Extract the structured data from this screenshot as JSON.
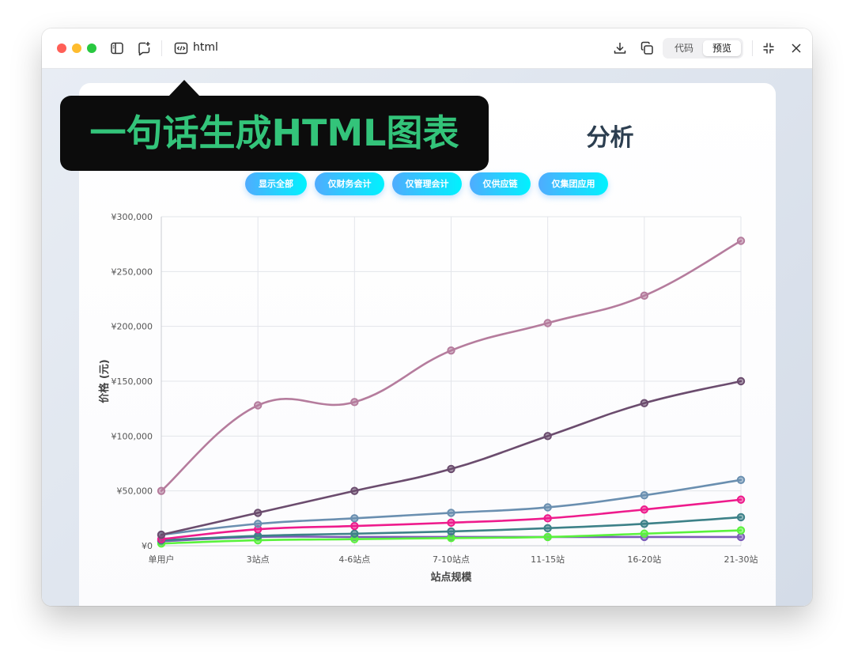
{
  "window": {
    "tab_title": "html",
    "view_toggle": {
      "code_label": "代码",
      "preview_label": "预览",
      "active": "预览"
    },
    "traffic_lights": [
      "#ff5f57",
      "#febc2e",
      "#28c840"
    ],
    "icons": [
      "sidebar-icon",
      "new-chat-icon",
      "code-file-icon",
      "download-icon",
      "copy-icon",
      "collapse-icon",
      "close-icon"
    ]
  },
  "banner": {
    "text": "一句话生成HTML图表",
    "color": "#33c47a"
  },
  "page": {
    "title_visible_fragment": "分析",
    "filters": [
      "显示全部",
      "仅财务会计",
      "仅管理会计",
      "仅供应链",
      "仅集团应用"
    ]
  },
  "chart_data": {
    "type": "line",
    "xlabel": "站点规模",
    "ylabel": "价格 (元)",
    "categories": [
      "单用户",
      "3站点",
      "4-6站点",
      "7-10站点",
      "11-15站",
      "16-20站",
      "21-30站"
    ],
    "ylim": [
      0,
      300000
    ],
    "yticks": [
      0,
      50000,
      100000,
      150000,
      200000,
      250000,
      300000
    ],
    "ytick_labels": [
      "¥0",
      "¥50,000",
      "¥100,000",
      "¥150,000",
      "¥200,000",
      "¥250,000",
      "¥300,000"
    ],
    "grid": true,
    "smooth": true,
    "series": [
      {
        "color": "#b57c9d",
        "values": [
          50000,
          128000,
          131000,
          178000,
          203000,
          228000,
          278000
        ]
      },
      {
        "color": "#6b4c6e",
        "values": [
          10000,
          30000,
          50000,
          70000,
          100000,
          130000,
          150000
        ]
      },
      {
        "color": "#6a8fb0",
        "values": [
          10000,
          20000,
          25000,
          30000,
          35000,
          46000,
          60000
        ]
      },
      {
        "color": "#ee1b8c",
        "values": [
          6000,
          15000,
          18000,
          21000,
          25000,
          33000,
          42000
        ]
      },
      {
        "color": "#3d8188",
        "values": [
          5000,
          9000,
          11000,
          13000,
          16000,
          20000,
          26000
        ]
      },
      {
        "color": "#5af23c",
        "values": [
          2000,
          5000,
          6000,
          7000,
          8000,
          11000,
          14000
        ]
      },
      {
        "color": "#7c5cb8",
        "values": [
          4000,
          8000,
          8000,
          8000,
          8000,
          8000,
          8000
        ]
      }
    ]
  }
}
